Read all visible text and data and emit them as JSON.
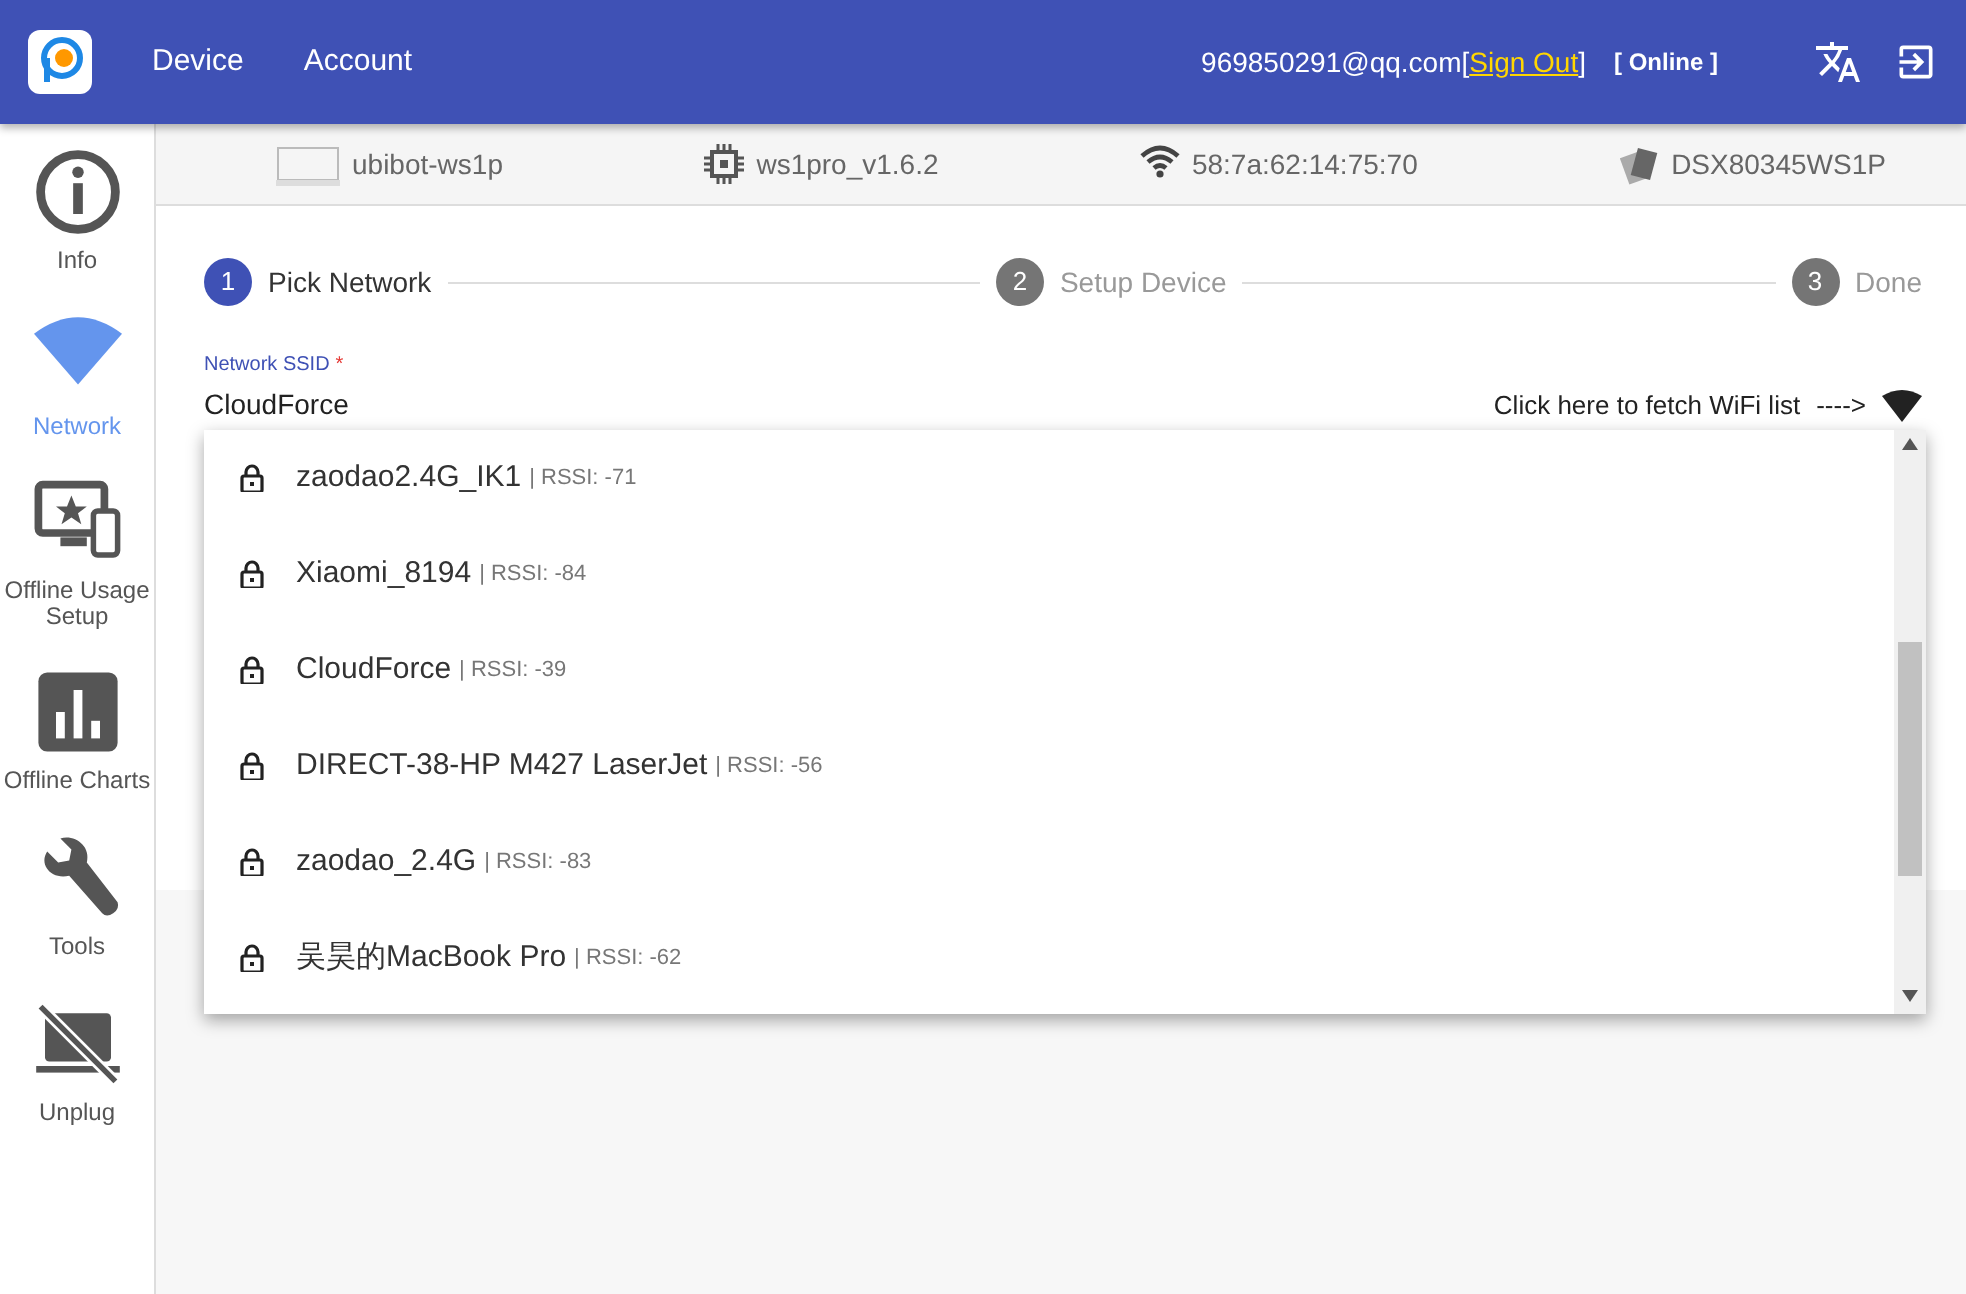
{
  "header": {
    "nav": [
      {
        "label": "Device"
      },
      {
        "label": "Account"
      }
    ],
    "email": "969850291@qq.com",
    "open_bracket": "[",
    "sign_out": "Sign Out",
    "close_bracket": "]",
    "status": "[ Online ]"
  },
  "sidebar": {
    "items": [
      {
        "kind": "info",
        "label": "Info",
        "selected": false
      },
      {
        "kind": "network",
        "label": "Network",
        "selected": true
      },
      {
        "kind": "offline-setup",
        "label": "Offline Usage Setup",
        "selected": false
      },
      {
        "kind": "charts",
        "label": "Offline Charts",
        "selected": false
      },
      {
        "kind": "tools",
        "label": "Tools",
        "selected": false
      },
      {
        "kind": "unplug",
        "label": "Unplug",
        "selected": false
      }
    ]
  },
  "device_info": [
    {
      "kind": "device",
      "text": "ubibot-ws1p"
    },
    {
      "kind": "firmware",
      "text": "ws1pro_v1.6.2"
    },
    {
      "kind": "mac",
      "text": "58:7a:62:14:75:70"
    },
    {
      "kind": "serial",
      "text": "DSX80345WS1P"
    }
  ],
  "steps": [
    {
      "number": "1",
      "label": "Pick Network",
      "selected": true
    },
    {
      "number": "2",
      "label": "Setup Device",
      "selected": false
    },
    {
      "number": "3",
      "label": "Done",
      "selected": false
    }
  ],
  "ssid_field": {
    "label": "Network SSID",
    "required_mark": "*",
    "value": "CloudForce",
    "fetch_hint": "Click here to fetch WiFi list",
    "arrow": "---->"
  },
  "wifi_list": [
    {
      "ssid": "zaodao2.4G_IK1",
      "rssi": "| RSSI: -71",
      "secured": true
    },
    {
      "ssid": "Xiaomi_8194",
      "rssi": "| RSSI: -84",
      "secured": true
    },
    {
      "ssid": "CloudForce",
      "rssi": "| RSSI: -39",
      "secured": true
    },
    {
      "ssid": "DIRECT-38-HP M427 LaserJet",
      "rssi": "| RSSI: -56",
      "secured": true
    },
    {
      "ssid": "zaodao_2.4G",
      "rssi": "| RSSI: -83",
      "secured": true
    },
    {
      "ssid": "吴昊的MacBook Pro",
      "rssi": "| RSSI: -62",
      "secured": true
    }
  ]
}
